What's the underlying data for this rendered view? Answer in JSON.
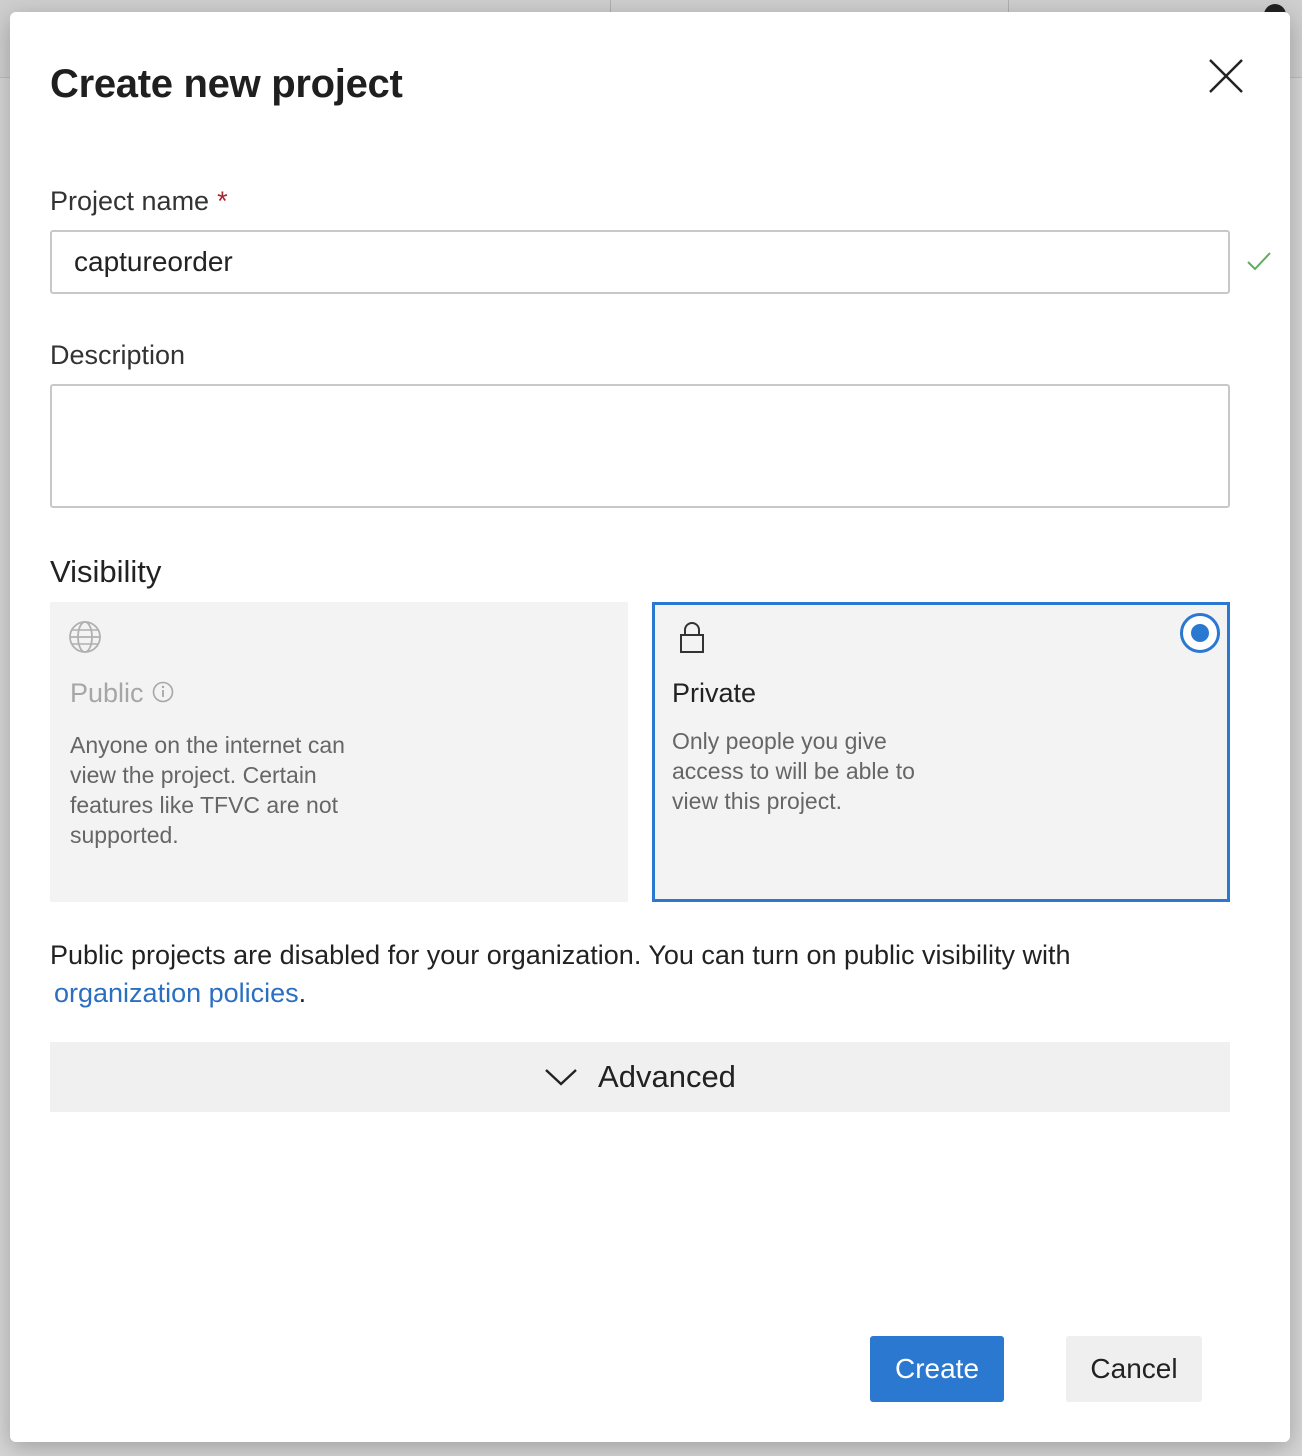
{
  "dialog": {
    "title": "Create new project",
    "close_icon": "close-icon"
  },
  "project_name": {
    "label": "Project name",
    "required_marker": "*",
    "value": "captureorder",
    "valid_icon": "checkmark-icon"
  },
  "description": {
    "label": "Description",
    "value": ""
  },
  "visibility": {
    "label": "Visibility",
    "selected": "private",
    "options": [
      {
        "id": "public",
        "icon": "globe-icon",
        "title": "Public",
        "info_icon": "info-icon",
        "description": "Anyone on the internet can view the project. Certain features like TFVC are not supported.",
        "disabled": true
      },
      {
        "id": "private",
        "icon": "lock-icon",
        "title": "Private",
        "description": "Only people you give access to will be able to view this project.",
        "disabled": false
      }
    ]
  },
  "notice": {
    "text": "Public projects are disabled for your organization. You can turn on public visibility with",
    "link_text": "organization policies",
    "suffix": "."
  },
  "advanced": {
    "label": "Advanced",
    "icon": "chevron-down-icon"
  },
  "actions": {
    "create_label": "Create",
    "cancel_label": "Cancel"
  },
  "colors": {
    "accent": "#2b78d1",
    "link": "#2b6fc1",
    "required": "#a4262c",
    "valid": "#5cae5c"
  }
}
